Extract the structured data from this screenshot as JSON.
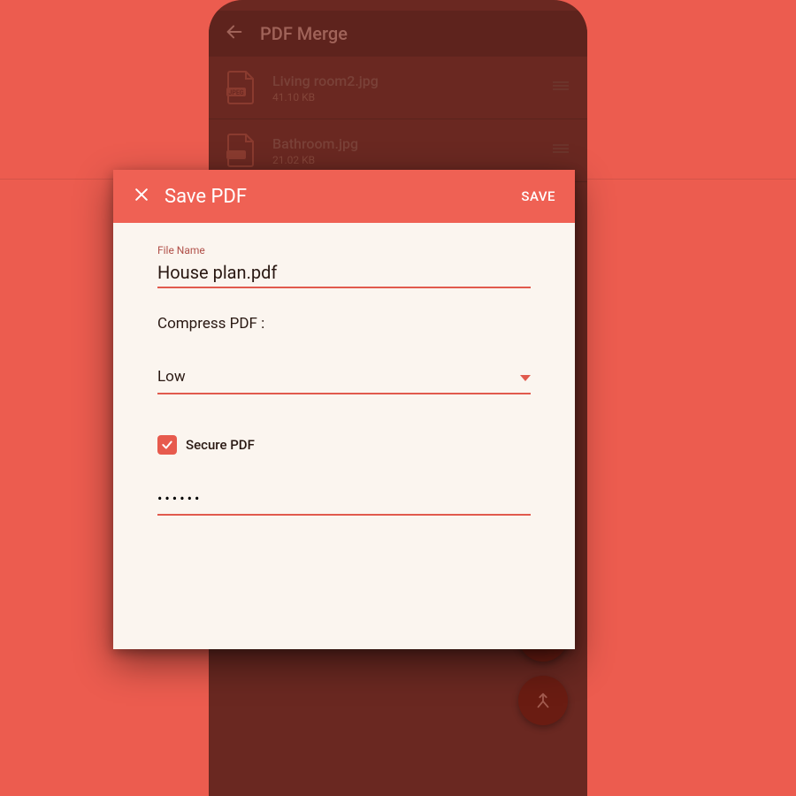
{
  "appbar": {
    "title": "PDF Merge"
  },
  "files": [
    {
      "name": "Living room2.jpg",
      "size": "41.10 KB"
    },
    {
      "name": "Bathroom.jpg",
      "size": "21.02 KB"
    }
  ],
  "dialog": {
    "title": "Save PDF",
    "action": "SAVE",
    "filename_label": "File Name",
    "filename_value": "House plan.pdf",
    "compress_label": "Compress PDF :",
    "compress_value": "Low",
    "secure_label": "Secure PDF",
    "password_value": "••••••"
  }
}
